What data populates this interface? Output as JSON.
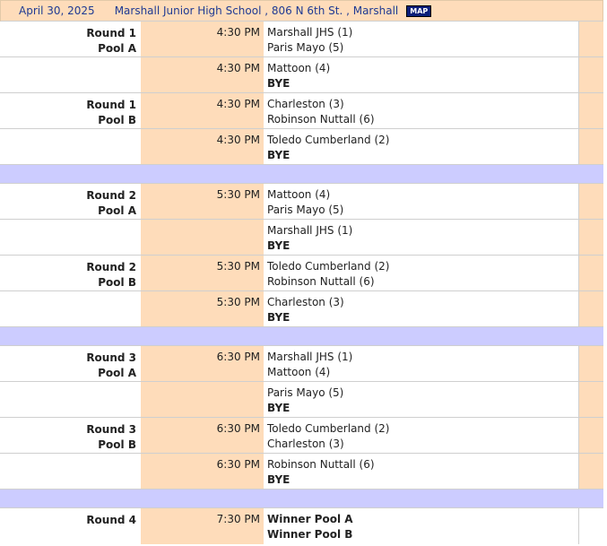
{
  "header": {
    "date": "April 30, 2025",
    "venue": "Marshall Junior High School , 806 N 6th St. , Marshall",
    "map_label": "MAP"
  },
  "rows": [
    {
      "round": "Round 1",
      "pool": "Pool A",
      "time": "4:30 PM",
      "team1": "Marshall JHS (1)",
      "team2": "Paris Mayo (5)"
    },
    {
      "round": "",
      "pool": "",
      "time": "4:30 PM",
      "team1": "Mattoon (4)",
      "team2": "BYE"
    },
    {
      "round": "Round 1",
      "pool": "Pool B",
      "time": "4:30 PM",
      "team1": "Charleston (3)",
      "team2": "Robinson Nuttall (6)"
    },
    {
      "round": "",
      "pool": "",
      "time": "4:30 PM",
      "team1": "Toledo Cumberland (2)",
      "team2": "BYE"
    },
    {
      "round": "Round 2",
      "pool": "Pool A",
      "time": "5:30 PM",
      "team1": "Mattoon (4)",
      "team2": "Paris Mayo (5)"
    },
    {
      "round": "",
      "pool": "",
      "time": "",
      "team1": "Marshall JHS (1)",
      "team2": "BYE"
    },
    {
      "round": "Round 2",
      "pool": "Pool B",
      "time": "5:30 PM",
      "team1": "Toledo Cumberland (2)",
      "team2": "Robinson Nuttall (6)"
    },
    {
      "round": "",
      "pool": "",
      "time": "5:30 PM",
      "team1": "Charleston (3)",
      "team2": "BYE"
    },
    {
      "round": "Round 3",
      "pool": "Pool A",
      "time": "6:30 PM",
      "team1": "Marshall JHS (1)",
      "team2": "Mattoon (4)"
    },
    {
      "round": "",
      "pool": "",
      "time": "",
      "team1": "Paris Mayo (5)",
      "team2": "BYE"
    },
    {
      "round": "Round 3",
      "pool": "Pool B",
      "time": "6:30 PM",
      "team1": "Toledo Cumberland (2)",
      "team2": "Charleston (3)"
    },
    {
      "round": "",
      "pool": "",
      "time": "6:30 PM",
      "team1": "Robinson Nuttall (6)",
      "team2": "BYE"
    },
    {
      "round": "Round 4",
      "pool": "",
      "time": "7:30 PM",
      "team1": "Winner Pool A",
      "team2": "Winner Pool B"
    }
  ],
  "colors": {
    "time_bg": "#fedcba",
    "separator": "#ccccff",
    "header_text": "#1f3a93"
  }
}
